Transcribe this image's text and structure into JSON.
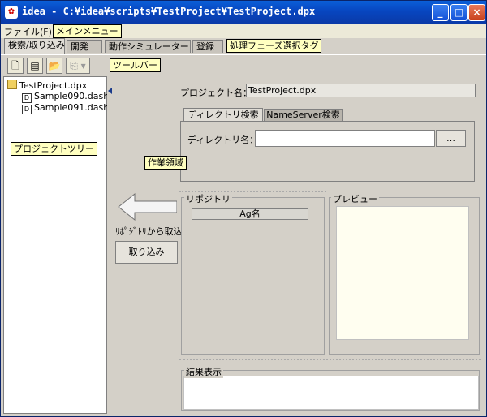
{
  "window": {
    "title": "idea - C:¥idea¥scripts¥TestProject¥TestProject.dpx",
    "minimize_glyph": "_",
    "maximize_glyph": "□",
    "close_glyph": "×",
    "titlebar_color": "#0846c0"
  },
  "menubar": {
    "file_label": "ファイル(F)"
  },
  "annotations": {
    "main_menu": "メインメニュー",
    "phase_tags": "処理フェーズ選択タグ",
    "toolbar": "ツールバー",
    "project_tree": "プロジェクトツリー",
    "work_area": "作業領域"
  },
  "phase_tabs": [
    {
      "label": "検索/取り込み",
      "active": true
    },
    {
      "label": "開発",
      "active": false
    },
    {
      "label": "動作シミュレーター",
      "active": false
    },
    {
      "label": "登録",
      "active": false
    }
  ],
  "toolbar": {
    "icons": [
      "new-file-icon",
      "open-project-icon",
      "open-folder-icon",
      "copy-icon"
    ]
  },
  "tree": {
    "root": "TestProject.dpx",
    "items": [
      "Sample090.dash",
      "Sample091.dash"
    ]
  },
  "work": {
    "project_name_label": "プロジェクト名：",
    "project_name_value": "TestProject.dpx",
    "search_tabs": [
      "ディレクトリ検索",
      "NameServer検索"
    ],
    "directory_label": "ディレクトリ名：",
    "directory_value": "",
    "browse_label": "…",
    "import_from_repo_label": "ﾘﾎﾟｼﾞﾄﾘから取込",
    "import_button": "取り込み",
    "repository_title": "リポジトリ",
    "ag_column": "Ag名",
    "preview_title": "プレビュー",
    "result_title": "結果表示"
  }
}
